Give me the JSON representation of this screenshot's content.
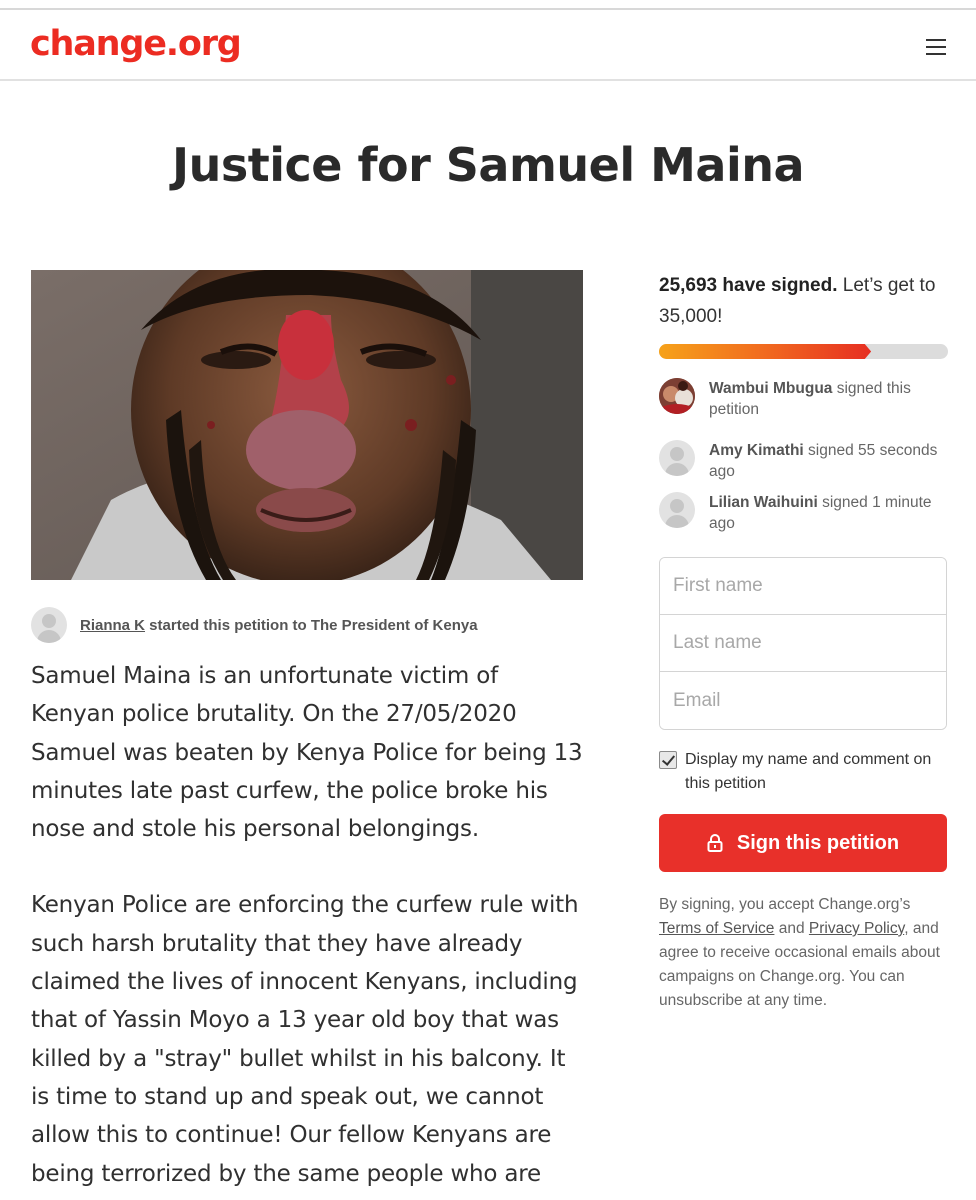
{
  "header": {
    "logo": "change.org",
    "menu_icon": "hamburger-menu-icon"
  },
  "petition": {
    "title": "Justice for Samuel Maina",
    "image_alt": "Samuel Maina injured face",
    "starter_name": "Rianna K",
    "starter_text": " started this petition to The President of Kenya",
    "story": [
      "Samuel Maina is an unfortunate victim of Kenyan police brutality. On the 27/05/2020 Samuel was beaten by Kenya Police for being 13 minutes late past curfew, the police broke his nose and stole his personal belongings.",
      "Kenyan Police are enforcing the curfew rule with such harsh brutality that they have already claimed the lives of innocent Kenyans, including that of Yassin Moyo a 13 year old boy that was killed by a \"stray\" bullet whilst in his balcony. It is time to stand up and speak out, we cannot allow this to continue! Our fellow Kenyans are being terrorized by the same people who are"
    ]
  },
  "sidebar": {
    "count_bold": "25,693 have signed.",
    "count_rest": " Let’s get to 35,000!",
    "progress_fraction": 0.7341,
    "progress_colors": [
      "#f6a21a",
      "#f16a1f",
      "#e62f22"
    ],
    "recent_signers": [
      {
        "name": "Wambui Mbugua",
        "action": " signed this petition"
      },
      {
        "name": "Amy Kimathi",
        "action": " signed 55 seconds ago"
      },
      {
        "name": "Lilian Waihuini",
        "action": " signed 1 minute ago"
      }
    ],
    "form": {
      "first_name_placeholder": "First name",
      "last_name_placeholder": "Last name",
      "email_placeholder": "Email"
    },
    "consent_label": "Display my name and comment on this petition",
    "consent_checked": true,
    "sign_button_label": "Sign this petition",
    "legal": {
      "prefix": "By signing, you accept Change.org’s ",
      "terms_link": "Terms of Service",
      "and": " and ",
      "privacy_link": "Privacy Policy",
      "suffix": ", and agree to receive occasional emails about campaigns on Change.org. You can unsubscribe at any time."
    }
  },
  "colors": {
    "brand_red": "#ec2c22",
    "button_red": "#e8302a"
  }
}
